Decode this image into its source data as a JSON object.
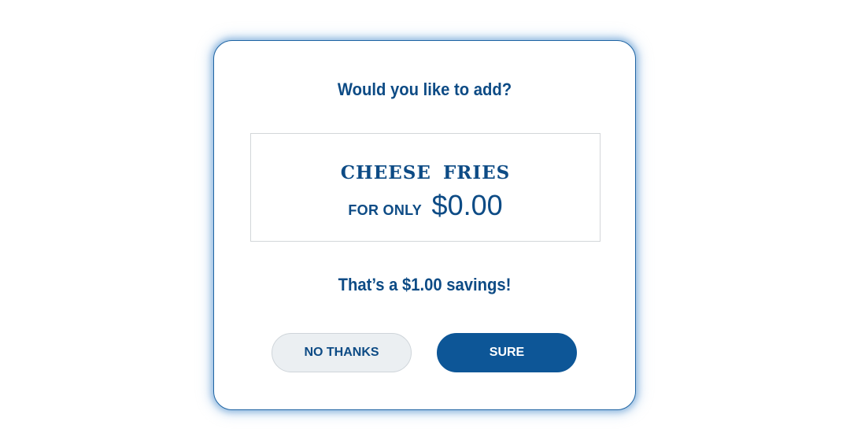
{
  "dialog": {
    "prompt": "Would you like to add?",
    "offer": {
      "product_name": "CHEESE FRIES",
      "for_only_label": "FOR ONLY",
      "price": "$0.00"
    },
    "savings_text": "That’s a $1.00 savings!",
    "buttons": {
      "decline_label": "NO THANKS",
      "accept_label": "SURE"
    }
  },
  "colors": {
    "brand_blue": "#0d4b85",
    "button_blue": "#0d5697",
    "secondary_button_bg": "#ebeff2"
  }
}
